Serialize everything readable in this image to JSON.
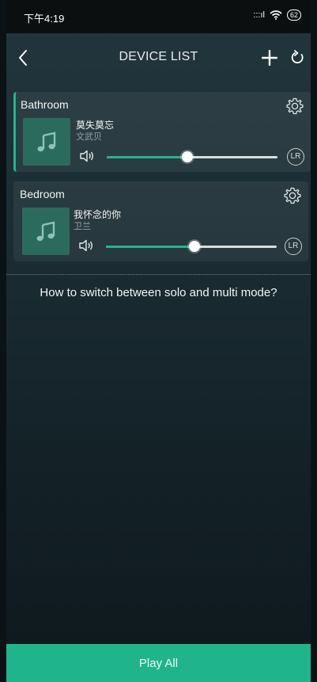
{
  "status_bar": {
    "time": "下午4:19",
    "signal": ":::ıl",
    "battery": "62"
  },
  "header": {
    "title": "DEVICE LIST"
  },
  "devices": [
    {
      "name": "Bathroom",
      "track_title": "莫失莫忘",
      "artist": "文武贝",
      "volume_percent": 47,
      "channel": "LR",
      "selected": true
    },
    {
      "name": "Bedroom",
      "track_title": "我怀念的你",
      "artist": "卫兰",
      "volume_percent": 52,
      "channel": "LR",
      "selected": false
    }
  ],
  "help_text": "How to switch between solo and multi mode?",
  "play_all_label": "Play All",
  "colors": {
    "accent": "#22b48f",
    "art_bg": "#2a6b5d"
  },
  "icons": [
    "back-icon",
    "add-icon",
    "refresh-icon",
    "gear-icon",
    "music-note-icon",
    "speaker-icon"
  ]
}
